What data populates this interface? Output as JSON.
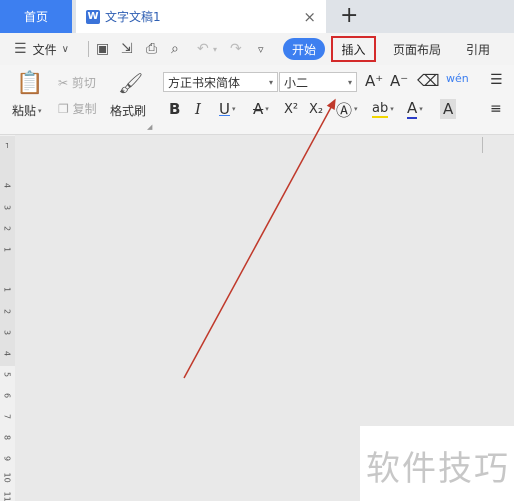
{
  "tabs": {
    "home": "首页",
    "document_icon": "W",
    "document": "文字文稿1",
    "close": "×",
    "new": "+"
  },
  "menu": {
    "file": "文件",
    "start": "开始",
    "insert": "插入",
    "page_layout": "页面布局",
    "reference": "引用"
  },
  "ribbon": {
    "paste": "粘贴",
    "cut": "剪切",
    "copy": "复制",
    "format_painter": "格式刷",
    "font_name": "方正书宋简体",
    "font_size": "小二",
    "bold": "B",
    "italic": "I",
    "underline": "U",
    "strike": "A",
    "superscript": "X²",
    "subscript": "X₂",
    "font_grow": "A⁺",
    "font_shrink": "A⁻",
    "phonetic": "wén",
    "highlight_label": "ab",
    "font_color_label": "A",
    "char_shade_label": "A"
  },
  "ruler": {
    "top_numbers": [
      "4",
      "3",
      "2",
      "1"
    ],
    "bottom_numbers": [
      "1",
      "2",
      "3",
      "4",
      "5",
      "6",
      "7",
      "8",
      "9",
      "10",
      "11"
    ]
  },
  "watermark": "软件技巧",
  "colors": {
    "accent": "#3d7ff0",
    "highlight_box": "#d42a2a",
    "arrow": "#c0392b"
  }
}
